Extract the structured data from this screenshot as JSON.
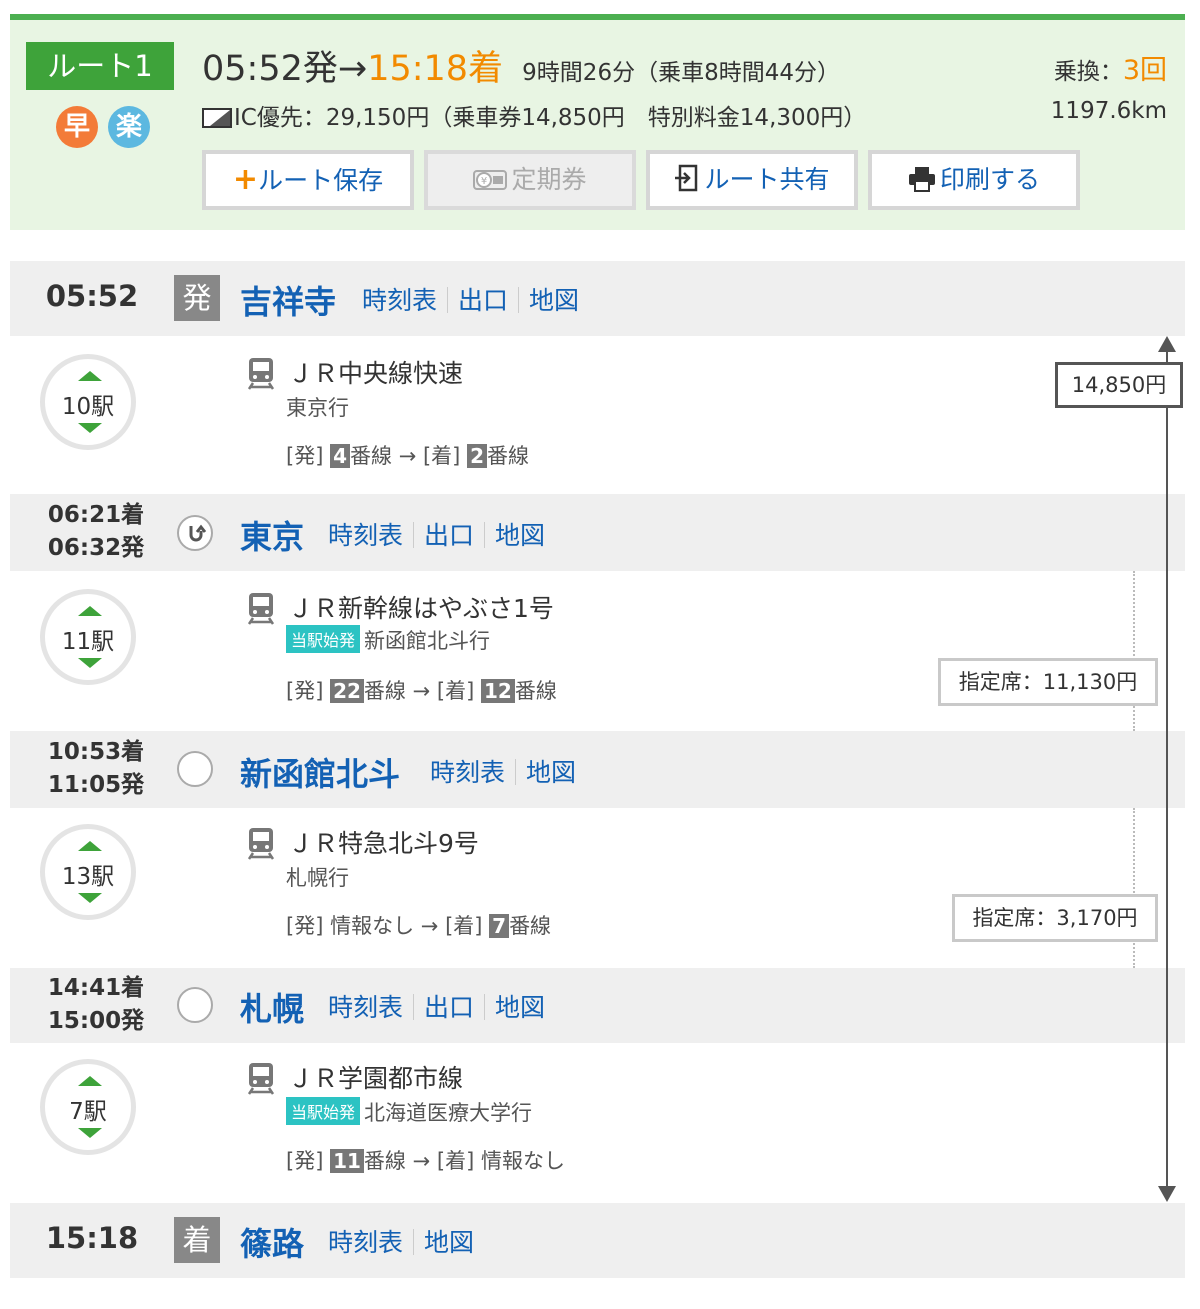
{
  "summary": {
    "route_label": "ルート1",
    "mark_fast": "早",
    "mark_easy": "楽",
    "dep_time": "05:52発",
    "arrow": "→",
    "arr_time": "15:18着",
    "duration": "9時間26分（乗車8時間44分）",
    "transfer_label": "乗換：",
    "transfer_count": "3回",
    "fare": "IC優先：29,150円（乗車券14,850円　特別料金14,300円）",
    "distance": "1197.6km",
    "buttons": {
      "save": "ルート保存",
      "teiki": "定期券",
      "share": "ルート共有",
      "print": "印刷する"
    }
  },
  "links": {
    "timetable": "時刻表",
    "exit": "出口",
    "map": "地図"
  },
  "stations": [
    {
      "time": "05:52",
      "tag": "発",
      "name": "吉祥寺"
    },
    {
      "arr": "06:21着",
      "dep": "06:32発",
      "name": "東京"
    },
    {
      "arr": "10:53着",
      "dep": "11:05発",
      "name": "新函館北斗"
    },
    {
      "arr": "14:41着",
      "dep": "15:00発",
      "name": "札幌"
    },
    {
      "time": "15:18",
      "tag": "着",
      "name": "篠路"
    }
  ],
  "legs": [
    {
      "stops": "10駅",
      "train": "ＪＲ中央線快速",
      "origin_badge": "",
      "dest": "東京行",
      "dep_label": "[発]",
      "dep_platform": "4",
      "dep_unit": "番線",
      "arrow": "→",
      "arr_label": "[着]",
      "arr_platform": "2",
      "arr_unit": "番線",
      "line_color": "#f26522"
    },
    {
      "stops": "11駅",
      "train": "ＪＲ新幹線はやぶさ1号",
      "origin_badge": "当駅始発",
      "dest": "新函館北斗行",
      "dep_label": "[発]",
      "dep_platform": "22",
      "dep_unit": "番線",
      "arrow": "→",
      "arr_label": "[着]",
      "arr_platform": "12",
      "arr_unit": "番線",
      "seat_fare": "指定席：11,130円",
      "line_color": "#1a8a1a"
    },
    {
      "stops": "13駅",
      "train": "ＪＲ特急北斗9号",
      "origin_badge": "",
      "dest": "札幌行",
      "dep_label": "[発]",
      "dep_info": "情報なし",
      "arrow": "→",
      "arr_label": "[着]",
      "arr_platform": "7",
      "arr_unit": "番線",
      "seat_fare": "指定席：3,170円",
      "line_color": "#e8141e"
    },
    {
      "stops": "7駅",
      "train": "ＪＲ学園都市線",
      "origin_badge": "当駅始発",
      "dest": "北海道医療大学行",
      "dep_label": "[発]",
      "dep_platform": "11",
      "dep_unit": "番線",
      "arrow": "→",
      "arr_label": "[着]",
      "arr_info": "情報なし",
      "line_color": "#e8141e"
    }
  ],
  "base_fare": "14,850円"
}
